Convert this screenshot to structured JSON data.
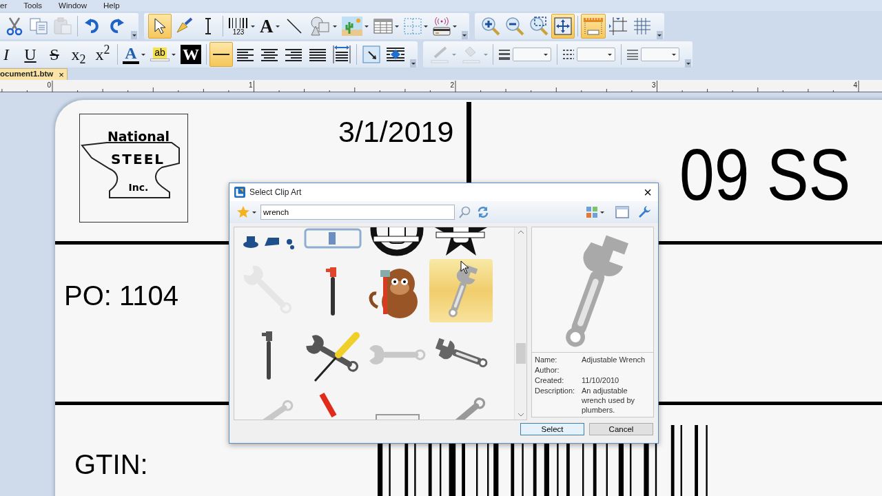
{
  "menu": [
    {
      "label": "er"
    },
    {
      "label": "Tools"
    },
    {
      "label": "Window"
    },
    {
      "label": "Help"
    }
  ],
  "toolbars": [
    [
      {
        "items": [
          {
            "kind": "cut"
          },
          {
            "kind": "copy"
          },
          {
            "kind": "paste",
            "disabled": true
          },
          {
            "kind": "separator"
          },
          {
            "kind": "undo"
          },
          {
            "kind": "redo"
          }
        ]
      },
      {
        "items": [
          {
            "kind": "pointer",
            "on": true
          },
          {
            "kind": "brush"
          },
          {
            "kind": "text-cursor"
          },
          {
            "kind": "separator"
          },
          {
            "kind": "barcode",
            "label": "123",
            "dropdown": true
          },
          {
            "kind": "text",
            "label": "A",
            "dropdown": true
          },
          {
            "kind": "line"
          },
          {
            "kind": "shapes",
            "dropdown": true
          },
          {
            "kind": "picture",
            "dropdown": true
          },
          {
            "kind": "table",
            "dropdown": true
          },
          {
            "kind": "grid",
            "dropdown": true
          },
          {
            "kind": "rfid",
            "dropdown": true
          }
        ]
      },
      {
        "items": [
          {
            "kind": "zoom-in"
          },
          {
            "kind": "zoom-out"
          },
          {
            "kind": "zoom-select"
          },
          {
            "kind": "fit",
            "on": true
          },
          {
            "kind": "separator"
          },
          {
            "kind": "ruler",
            "on": true
          },
          {
            "kind": "margins"
          },
          {
            "kind": "grid-lines"
          }
        ]
      }
    ],
    [
      {
        "items": [
          {
            "kind": "italic",
            "label": "I"
          },
          {
            "kind": "underline",
            "label": "U"
          },
          {
            "kind": "strike",
            "label": "S"
          },
          {
            "kind": "subscript",
            "label": "x$_{2}$"
          },
          {
            "kind": "superscript",
            "label": "x$^{2}$"
          },
          {
            "kind": "separator"
          },
          {
            "kind": "font-color",
            "label": "A",
            "dropdown": true
          },
          {
            "kind": "highlight",
            "label": "ab",
            "dropdown": true
          },
          {
            "kind": "inverse",
            "label": "W"
          },
          {
            "kind": "separator"
          },
          {
            "kind": "line-style",
            "on": true
          },
          {
            "kind": "align-left"
          },
          {
            "kind": "align-center"
          },
          {
            "kind": "align-right"
          },
          {
            "kind": "justify"
          },
          {
            "kind": "spacing"
          },
          {
            "kind": "separator"
          },
          {
            "kind": "anchor"
          },
          {
            "kind": "position"
          }
        ]
      },
      {
        "items": [
          {
            "kind": "pen",
            "dropdown": true,
            "disabled": true
          },
          {
            "kind": "fill",
            "dropdown": true,
            "disabled": true
          },
          {
            "kind": "separator"
          },
          {
            "kind": "line-width"
          },
          {
            "kind": "separator"
          },
          {
            "kind": "dash"
          },
          {
            "kind": "separator"
          },
          {
            "kind": "line-type"
          }
        ]
      }
    ]
  ],
  "document_tab": {
    "title": "ocument1.btw",
    "close": "×"
  },
  "ruler": {
    "labels": [
      "0",
      "1",
      "2",
      "3",
      "4"
    ]
  },
  "label": {
    "logo": {
      "top": "National",
      "middle": "STEEL",
      "bottom": "Inc."
    },
    "date": "3/1/2019",
    "product": "09 SS",
    "po": "PO: 1104",
    "gtin": "GTIN:"
  },
  "dialog": {
    "title": "Select Clip Art",
    "close": "×",
    "search": {
      "value": "wrench"
    },
    "items": [
      {
        "kind": "figures",
        "selected": false
      },
      {
        "kind": "banner",
        "selected": false
      },
      {
        "kind": "ring-figure",
        "selected": false
      },
      {
        "kind": "star-figure",
        "selected": false
      },
      {
        "kind": "ratchet",
        "selected": false
      },
      {
        "kind": "pipe-wrench",
        "selected": false
      },
      {
        "kind": "monkey",
        "selected": false
      },
      {
        "kind": "adjustable-wrench",
        "selected": true
      },
      {
        "kind": "pipe-wrench-dark",
        "selected": false
      },
      {
        "kind": "crossed-tools",
        "selected": false
      },
      {
        "kind": "open-wrench",
        "selected": false
      },
      {
        "kind": "adjustable-wrench-flat",
        "selected": false
      },
      {
        "kind": "wrench-spanner",
        "selected": false
      },
      {
        "kind": "red-tool",
        "selected": false
      },
      {
        "kind": "document",
        "selected": false
      },
      {
        "kind": "wrench-sleeve",
        "selected": false
      }
    ],
    "details": [
      {
        "label": "Name:",
        "value": "Adjustable Wrench"
      },
      {
        "label": "Author:"
      },
      {
        "label": "Created:",
        "value": "11/10/2010"
      },
      {
        "label": "Description:",
        "value": "An adjustable wrench used by plumbers."
      }
    ],
    "buttons": [
      {
        "label": "Select",
        "kind": "default"
      },
      {
        "label": "Cancel",
        "kind": "normal"
      }
    ]
  }
}
